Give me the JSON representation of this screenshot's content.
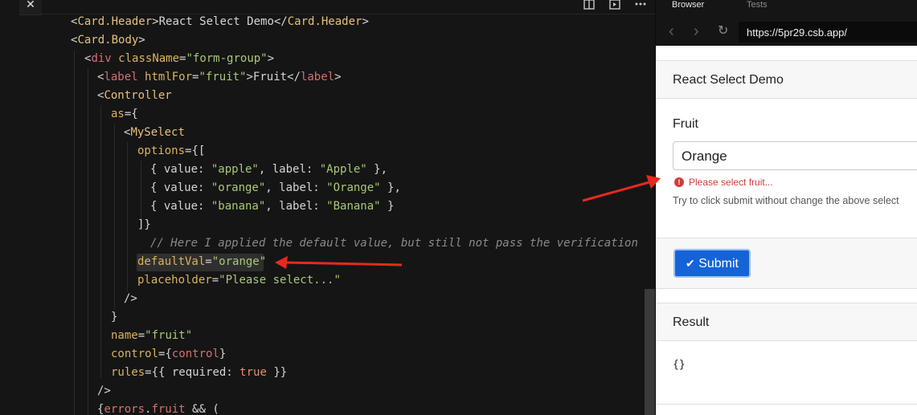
{
  "editor": {
    "close_glyph": "✕",
    "lines": [
      {
        "indent": 88,
        "tokens": [
          [
            "punct",
            "<"
          ],
          [
            "tag",
            "Card.Header"
          ],
          [
            "punct",
            ">React Select Demo</"
          ],
          [
            "tag",
            "Card.Header"
          ],
          [
            "punct",
            ">"
          ]
        ]
      },
      {
        "indent": 88,
        "tokens": [
          [
            "punct",
            "<"
          ],
          [
            "tag",
            "Card.Body"
          ],
          [
            "punct",
            ">"
          ]
        ]
      },
      {
        "indent": 105,
        "tokens": [
          [
            "punct",
            "<"
          ],
          [
            "tag2",
            "div"
          ],
          [
            "punct",
            " "
          ],
          [
            "attr",
            "className"
          ],
          [
            "punct",
            "="
          ],
          [
            "str",
            "\"form-group\""
          ],
          [
            "punct",
            ">"
          ]
        ]
      },
      {
        "indent": 121,
        "tokens": [
          [
            "punct",
            "<"
          ],
          [
            "tag2",
            "label"
          ],
          [
            "punct",
            " "
          ],
          [
            "attr",
            "htmlFor"
          ],
          [
            "punct",
            "="
          ],
          [
            "str",
            "\"fruit\""
          ],
          [
            "punct",
            ">Fruit</"
          ],
          [
            "tag2",
            "label"
          ],
          [
            "punct",
            ">"
          ]
        ]
      },
      {
        "indent": 121,
        "tokens": [
          [
            "punct",
            "<"
          ],
          [
            "tag",
            "Controller"
          ]
        ]
      },
      {
        "indent": 138,
        "tokens": [
          [
            "attr",
            "as"
          ],
          [
            "punct",
            "={"
          ]
        ]
      },
      {
        "indent": 154,
        "tokens": [
          [
            "punct",
            "<"
          ],
          [
            "tag",
            "MySelect"
          ]
        ]
      },
      {
        "indent": 171,
        "tokens": [
          [
            "attr",
            "options"
          ],
          [
            "punct",
            "={["
          ]
        ]
      },
      {
        "indent": 187,
        "tokens": [
          [
            "punct",
            "{ value: "
          ],
          [
            "str",
            "\"apple\""
          ],
          [
            "punct",
            ", label: "
          ],
          [
            "str",
            "\"Apple\""
          ],
          [
            "punct",
            " },"
          ]
        ]
      },
      {
        "indent": 187,
        "tokens": [
          [
            "punct",
            "{ value: "
          ],
          [
            "str",
            "\"orange\""
          ],
          [
            "punct",
            ", label: "
          ],
          [
            "str",
            "\"Orange\""
          ],
          [
            "punct",
            " },"
          ]
        ]
      },
      {
        "indent": 187,
        "tokens": [
          [
            "punct",
            "{ value: "
          ],
          [
            "str",
            "\"banana\""
          ],
          [
            "punct",
            ", label: "
          ],
          [
            "str",
            "\"Banana\""
          ],
          [
            "punct",
            " }"
          ]
        ]
      },
      {
        "indent": 171,
        "tokens": [
          [
            "punct",
            "]}"
          ]
        ]
      },
      {
        "indent": 187,
        "tokens": [
          [
            "cmt",
            "// Here I applied the default value, but still not pass the verification"
          ]
        ]
      },
      {
        "indent": 171,
        "tokens": [
          [
            "attr",
            "defaultVal"
          ],
          [
            "punct",
            "="
          ],
          [
            "str",
            "\"orange\""
          ]
        ]
      },
      {
        "indent": 171,
        "tokens": [
          [
            "attr",
            "placeholder"
          ],
          [
            "punct",
            "="
          ],
          [
            "str",
            "\"Please select...\""
          ]
        ]
      },
      {
        "indent": 154,
        "tokens": [
          [
            "punct",
            "/>"
          ]
        ]
      },
      {
        "indent": 138,
        "tokens": [
          [
            "punct",
            "}"
          ]
        ]
      },
      {
        "indent": 138,
        "tokens": [
          [
            "attr",
            "name"
          ],
          [
            "punct",
            "="
          ],
          [
            "str",
            "\"fruit\""
          ]
        ]
      },
      {
        "indent": 138,
        "tokens": [
          [
            "attr",
            "control"
          ],
          [
            "punct",
            "={"
          ],
          [
            "tag2",
            "control"
          ],
          [
            "punct",
            "}"
          ]
        ]
      },
      {
        "indent": 138,
        "tokens": [
          [
            "attr",
            "rules"
          ],
          [
            "punct",
            "={{ required: "
          ],
          [
            "kw",
            "true"
          ],
          [
            "punct",
            " }}"
          ]
        ]
      },
      {
        "indent": 121,
        "tokens": [
          [
            "punct",
            "/>"
          ]
        ]
      },
      {
        "indent": 121,
        "tokens": [
          [
            "punct",
            "{"
          ],
          [
            "tag2",
            "errors"
          ],
          [
            "punct",
            "."
          ],
          [
            "tag2",
            "fruit"
          ],
          [
            "punct",
            " && ("
          ]
        ]
      }
    ]
  },
  "browser": {
    "tabs": [
      "Browser",
      "Tests"
    ],
    "url": "https://5pr29.csb.app/",
    "nav": {
      "back": "‹",
      "forward": "›",
      "reload": "↻"
    },
    "card1_header": "React Select Demo",
    "fruit_label": "Fruit",
    "select_value": "Orange",
    "error_icon": "!",
    "error_text": "Please select fruit...",
    "hint_text": "Try to click submit without change the above select",
    "submit_icon": "✔",
    "submit_label": "Submit",
    "card2_header": "Result",
    "result_text": "{}"
  },
  "colors": {
    "arrow": "#e8291c",
    "primary": "#1464d8",
    "error": "#d23b3b"
  }
}
